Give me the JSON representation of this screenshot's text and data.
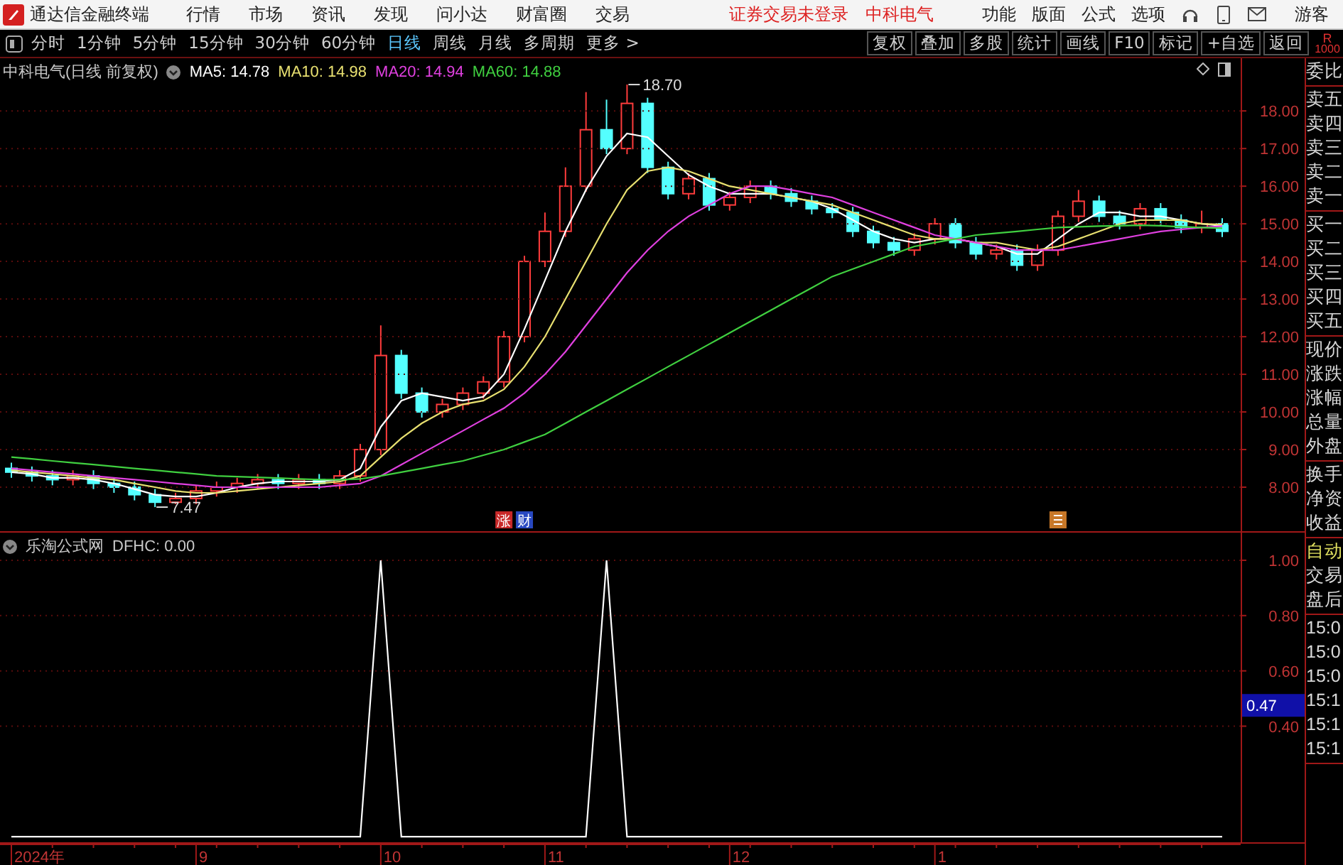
{
  "menubar": {
    "app_title": "通达信金融终端",
    "menus": [
      "行情",
      "市场",
      "资讯",
      "发现",
      "问小达",
      "财富圈",
      "交易"
    ],
    "login_status": "证券交易未登录",
    "stock_name": "中科电气",
    "tools": [
      "功能",
      "版面",
      "公式",
      "选项"
    ],
    "user": "游客"
  },
  "toolbar": {
    "periods": [
      {
        "label": "分时",
        "selected": false
      },
      {
        "label": "1分钟",
        "selected": false
      },
      {
        "label": "5分钟",
        "selected": false
      },
      {
        "label": "15分钟",
        "selected": false
      },
      {
        "label": "30分钟",
        "selected": false
      },
      {
        "label": "60分钟",
        "selected": false
      },
      {
        "label": "日线",
        "selected": true
      },
      {
        "label": "周线",
        "selected": false
      },
      {
        "label": "月线",
        "selected": false
      },
      {
        "label": "多周期",
        "selected": false
      },
      {
        "label": "更多 >",
        "selected": false
      }
    ],
    "actions": [
      "复权",
      "叠加",
      "多股",
      "统计",
      "画线",
      "F10",
      "标记",
      "+自选",
      "返回"
    ],
    "corner": [
      "R",
      "1000"
    ]
  },
  "main_chart": {
    "title": "中科电气(日线 前复权)",
    "date_labels": [
      "2024年",
      "9",
      "10",
      "11",
      "12",
      "1"
    ],
    "ma_values": [
      "14.78",
      "14.98",
      "14.94",
      "14.88"
    ],
    "markers": [
      {
        "kind": "text",
        "label": "涨",
        "color": "#c82828"
      },
      {
        "kind": "text",
        "label": "财",
        "color": "#2848c0"
      },
      {
        "kind": "icon",
        "color": "#c87828"
      }
    ],
    "chart_data": {
      "type": "candlestick",
      "ylim": [
        6.83,
        19.4
      ],
      "ohlc": [
        [
          8.5,
          8.65,
          8.25,
          8.4
        ],
        [
          8.4,
          8.55,
          8.15,
          8.3
        ],
        [
          8.3,
          8.45,
          8.05,
          8.2
        ],
        [
          8.2,
          8.45,
          8.05,
          8.3
        ],
        [
          8.3,
          8.45,
          7.95,
          8.1
        ],
        [
          8.1,
          8.25,
          7.85,
          8.0
        ],
        [
          8.0,
          8.15,
          7.65,
          7.8
        ],
        [
          7.8,
          7.95,
          7.47,
          7.6
        ],
        [
          7.6,
          7.85,
          7.55,
          7.7
        ],
        [
          7.7,
          8.05,
          7.55,
          7.9
        ],
        [
          7.9,
          8.15,
          7.75,
          8.0
        ],
        [
          8.0,
          8.25,
          7.85,
          8.1
        ],
        [
          8.1,
          8.35,
          7.95,
          8.2
        ],
        [
          8.2,
          8.35,
          7.95,
          8.1
        ],
        [
          8.1,
          8.35,
          7.95,
          8.2
        ],
        [
          8.2,
          8.35,
          7.95,
          8.1
        ],
        [
          8.1,
          8.45,
          7.95,
          8.3
        ],
        [
          8.3,
          9.15,
          8.15,
          9.0
        ],
        [
          9.0,
          12.3,
          8.85,
          11.5
        ],
        [
          11.5,
          11.65,
          10.35,
          10.5
        ],
        [
          10.5,
          10.65,
          9.85,
          10.0
        ],
        [
          10.0,
          10.35,
          9.85,
          10.2
        ],
        [
          10.2,
          10.65,
          10.05,
          10.5
        ],
        [
          10.5,
          10.95,
          10.35,
          10.8
        ],
        [
          10.8,
          12.15,
          10.65,
          12.0
        ],
        [
          12.0,
          14.15,
          11.85,
          14.0
        ],
        [
          14.0,
          15.3,
          13.85,
          14.8
        ],
        [
          14.8,
          16.5,
          14.65,
          16.0
        ],
        [
          16.0,
          18.5,
          15.85,
          17.5
        ],
        [
          17.5,
          18.3,
          16.85,
          17.0
        ],
        [
          17.0,
          18.7,
          16.85,
          18.2
        ],
        [
          18.2,
          18.35,
          16.35,
          16.5
        ],
        [
          16.5,
          16.65,
          15.65,
          15.8
        ],
        [
          15.8,
          16.35,
          15.65,
          16.2
        ],
        [
          16.2,
          16.35,
          15.35,
          15.5
        ],
        [
          15.5,
          15.85,
          15.35,
          15.7
        ],
        [
          15.7,
          16.15,
          15.55,
          16.0
        ],
        [
          16.0,
          16.15,
          15.65,
          15.8
        ],
        [
          15.8,
          15.95,
          15.45,
          15.6
        ],
        [
          15.6,
          15.75,
          15.25,
          15.4
        ],
        [
          15.4,
          15.55,
          15.15,
          15.3
        ],
        [
          15.3,
          15.45,
          14.65,
          14.8
        ],
        [
          14.8,
          14.95,
          14.35,
          14.5
        ],
        [
          14.5,
          14.65,
          14.15,
          14.3
        ],
        [
          14.3,
          14.75,
          14.15,
          14.6
        ],
        [
          14.6,
          15.15,
          14.45,
          15.0
        ],
        [
          15.0,
          15.15,
          14.35,
          14.5
        ],
        [
          14.5,
          14.65,
          14.05,
          14.2
        ],
        [
          14.2,
          14.45,
          14.05,
          14.3
        ],
        [
          14.3,
          14.45,
          13.75,
          13.9
        ],
        [
          13.9,
          14.45,
          13.75,
          14.3
        ],
        [
          14.3,
          15.35,
          14.15,
          15.2
        ],
        [
          15.2,
          15.9,
          15.05,
          15.6
        ],
        [
          15.6,
          15.75,
          15.05,
          15.2
        ],
        [
          15.2,
          15.35,
          14.85,
          15.0
        ],
        [
          15.0,
          15.55,
          14.85,
          15.4
        ],
        [
          15.4,
          15.55,
          14.95,
          15.1
        ],
        [
          15.1,
          15.25,
          14.75,
          14.9
        ],
        [
          14.9,
          15.35,
          14.75,
          15.0
        ],
        [
          15.0,
          15.15,
          14.65,
          14.8
        ]
      ],
      "annotations": [
        "18.70",
        "7.47"
      ]
    },
    "ma_chart": {
      "chart_data": {
        "type": "line",
        "grid": true,
        "ylim": [
          6.83,
          19.4
        ],
        "yticks": [
          {
            "value": 8,
            "label": "8.00"
          },
          {
            "value": 9,
            "label": "9.00"
          },
          {
            "value": 10,
            "label": "10.00"
          },
          {
            "value": 11,
            "label": "11.00"
          },
          {
            "value": 12,
            "label": "12.00"
          },
          {
            "value": 13,
            "label": "13.00"
          },
          {
            "value": 14,
            "label": "14.00"
          },
          {
            "value": 15,
            "label": "15.00"
          },
          {
            "value": 16,
            "label": "16.00"
          },
          {
            "value": 17,
            "label": "17.00"
          },
          {
            "value": 18,
            "label": "18.00"
          }
        ],
        "series": [
          {
            "name": "MA5:",
            "color": "#ffffff",
            "values": [
              8.4,
              8.35,
              8.25,
              8.25,
              8.2,
              8.1,
              7.95,
              7.8,
              7.75,
              7.75,
              7.85,
              8.0,
              8.1,
              8.15,
              8.15,
              8.15,
              8.2,
              8.5,
              9.6,
              10.3,
              10.5,
              10.4,
              10.3,
              10.4,
              11.0,
              12.2,
              13.5,
              14.8,
              15.9,
              16.8,
              17.4,
              17.3,
              16.8,
              16.3,
              16.0,
              15.8,
              15.8,
              15.8,
              15.7,
              15.6,
              15.4,
              15.1,
              14.8,
              14.6,
              14.5,
              14.6,
              14.6,
              14.5,
              14.4,
              14.2,
              14.2,
              14.6,
              15.0,
              15.3,
              15.3,
              15.2,
              15.2,
              15.1,
              15.0,
              14.95
            ]
          },
          {
            "name": "MA10:",
            "color": "#e8e070",
            "values": [
              8.45,
              8.4,
              8.35,
              8.3,
              8.25,
              8.2,
              8.1,
              8.0,
              7.9,
              7.85,
              7.85,
              7.9,
              7.95,
              8.0,
              8.05,
              8.1,
              8.15,
              8.3,
              8.8,
              9.3,
              9.7,
              10.0,
              10.2,
              10.3,
              10.6,
              11.2,
              12.0,
              13.0,
              14.0,
              15.0,
              15.9,
              16.4,
              16.5,
              16.4,
              16.2,
              16.0,
              15.9,
              15.8,
              15.7,
              15.6,
              15.5,
              15.3,
              15.1,
              14.9,
              14.7,
              14.6,
              14.6,
              14.5,
              14.5,
              14.4,
              14.3,
              14.4,
              14.6,
              14.8,
              15.0,
              15.1,
              15.1,
              15.1,
              15.0,
              14.98
            ]
          },
          {
            "name": "MA20:",
            "color": "#e040e0",
            "values": [
              8.5,
              8.45,
              8.4,
              8.35,
              8.3,
              8.25,
              8.2,
              8.15,
              8.1,
              8.05,
              8.0,
              8.0,
              8.0,
              8.0,
              8.0,
              8.0,
              8.05,
              8.1,
              8.3,
              8.6,
              8.9,
              9.2,
              9.5,
              9.8,
              10.1,
              10.5,
              11.0,
              11.6,
              12.3,
              13.0,
              13.7,
              14.3,
              14.8,
              15.2,
              15.5,
              15.8,
              16.0,
              16.0,
              15.9,
              15.8,
              15.7,
              15.5,
              15.3,
              15.1,
              14.9,
              14.7,
              14.6,
              14.5,
              14.4,
              14.3,
              14.3,
              14.3,
              14.4,
              14.5,
              14.6,
              14.7,
              14.8,
              14.85,
              14.9,
              14.94
            ]
          },
          {
            "name": "MA60:",
            "color": "#40d040",
            "values": [
              8.8,
              8.75,
              8.7,
              8.65,
              8.6,
              8.55,
              8.5,
              8.45,
              8.4,
              8.35,
              8.3,
              8.28,
              8.26,
              8.24,
              8.22,
              8.2,
              8.2,
              8.22,
              8.3,
              8.4,
              8.5,
              8.6,
              8.7,
              8.85,
              9.0,
              9.2,
              9.4,
              9.7,
              10.0,
              10.3,
              10.6,
              10.9,
              11.2,
              11.5,
              11.8,
              12.1,
              12.4,
              12.7,
              13.0,
              13.3,
              13.6,
              13.8,
              14.0,
              14.2,
              14.4,
              14.5,
              14.6,
              14.7,
              14.75,
              14.8,
              14.85,
              14.9,
              14.92,
              14.94,
              14.95,
              14.96,
              14.95,
              14.92,
              14.9,
              14.88
            ]
          }
        ]
      }
    }
  },
  "indicator": {
    "title": "乐淘公式网",
    "value": "0.00",
    "cursor_value": "0.47",
    "chart_data": {
      "type": "line",
      "grid": true,
      "ylim": [
        -0.02,
        1.1
      ],
      "yticks": [
        {
          "value": 0.4,
          "label": "0.40"
        },
        {
          "value": 0.6,
          "label": "0.60"
        },
        {
          "value": 0.8,
          "label": "0.80"
        },
        {
          "value": 1.0,
          "label": "1.00"
        }
      ],
      "series": [
        {
          "name": "DFHC:",
          "color": "#ffffff",
          "values": [
            0,
            0,
            0,
            0,
            0,
            0,
            0,
            0,
            0,
            0,
            0,
            0,
            0,
            0,
            0,
            0,
            0,
            0,
            1,
            0,
            0,
            0,
            0,
            0,
            0,
            0,
            0,
            0,
            0,
            1,
            0,
            0,
            0,
            0,
            0,
            0,
            0,
            0,
            0,
            0,
            0,
            0,
            0,
            0,
            0,
            0,
            0,
            0,
            0,
            0,
            0,
            0,
            0,
            0,
            0,
            0,
            0,
            0,
            0,
            0
          ]
        }
      ]
    }
  },
  "side_panel": {
    "groups": [
      {
        "items": [
          {
            "label": "委比"
          }
        ]
      },
      {
        "items": [
          {
            "label": "卖五"
          },
          {
            "label": "卖四"
          },
          {
            "label": "卖三"
          },
          {
            "label": "卖二"
          },
          {
            "label": "卖一"
          }
        ]
      },
      {
        "items": [
          {
            "label": "买一"
          },
          {
            "label": "买二"
          },
          {
            "label": "买三"
          },
          {
            "label": "买四"
          },
          {
            "label": "买五"
          }
        ]
      },
      {
        "items": [
          {
            "label": "现价"
          },
          {
            "label": "涨跌"
          },
          {
            "label": "涨幅"
          },
          {
            "label": "总量"
          },
          {
            "label": "外盘"
          }
        ]
      },
      {
        "items": [
          {
            "label": "换手"
          },
          {
            "label": "净资"
          },
          {
            "label": "收益"
          }
        ]
      },
      {
        "items": [
          {
            "label": "自动",
            "selected": true
          },
          {
            "label": "交易",
            "selected": false
          },
          {
            "label": "盘后",
            "selected": false
          }
        ]
      },
      {
        "items": [
          {
            "label": "15:0"
          },
          {
            "label": "15:0"
          },
          {
            "label": "15:0"
          },
          {
            "label": "15:1"
          },
          {
            "label": "15:1"
          },
          {
            "label": "15:1"
          }
        ]
      }
    ]
  }
}
